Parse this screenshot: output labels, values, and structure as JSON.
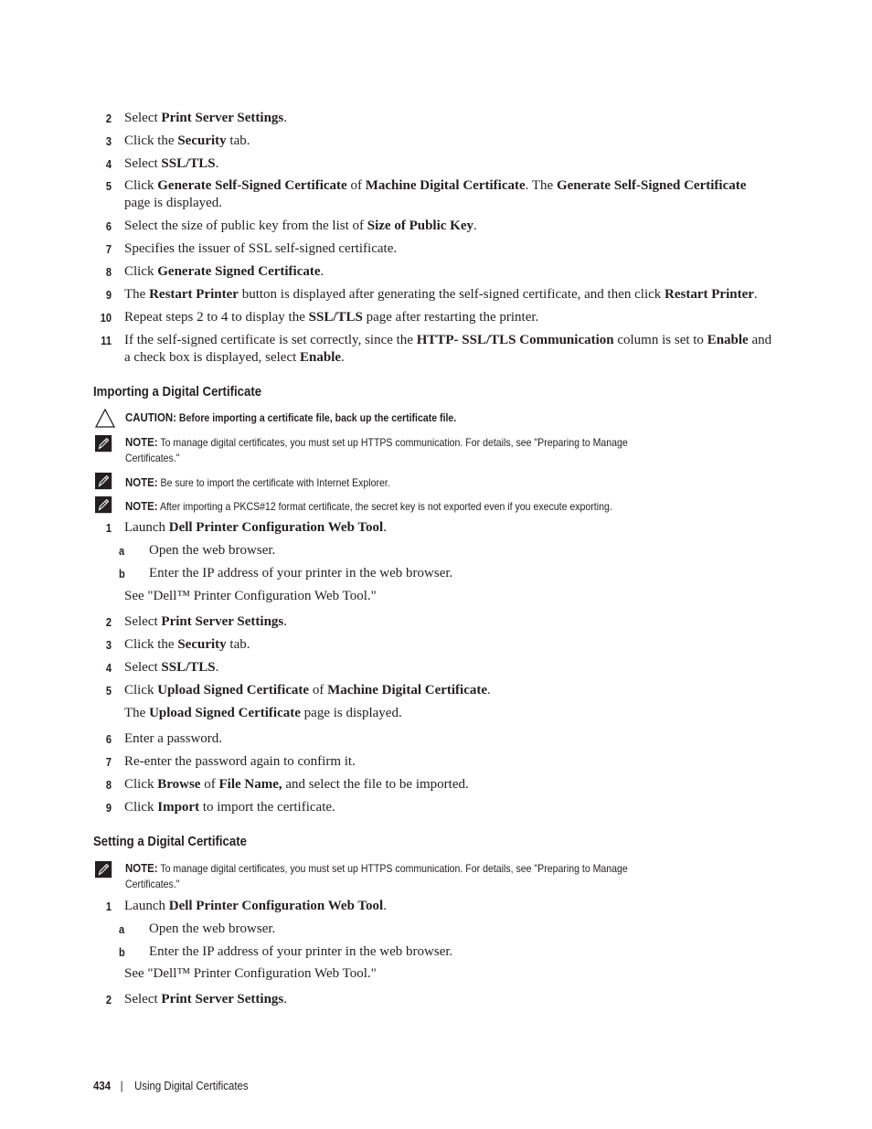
{
  "section1_steps": [
    {
      "num": "2",
      "parts": [
        "Select ",
        "Print Server Settings",
        "."
      ]
    },
    {
      "num": "3",
      "parts": [
        "Click the ",
        "Security",
        " tab."
      ]
    },
    {
      "num": "4",
      "parts": [
        "Select ",
        "SSL/TLS",
        "."
      ]
    },
    {
      "num": "5",
      "parts": [
        "Click ",
        "Generate Self-Signed Certificate",
        " of ",
        "Machine Digital Certificate",
        ". The ",
        "Generate Self-Signed Certificate",
        " page is displayed."
      ]
    },
    {
      "num": "6",
      "parts": [
        "Select the size of public key from the list of ",
        "Size of Public Key",
        "."
      ]
    },
    {
      "num": "7",
      "parts": [
        "Specifies the issuer of SSL self-signed certificate."
      ]
    },
    {
      "num": "8",
      "parts": [
        "Click ",
        "Generate Signed Certificate",
        "."
      ]
    },
    {
      "num": "9",
      "parts": [
        "The ",
        "Restart Printer",
        " button is displayed after generating the self-signed certificate, and then click ",
        "Restart Printer",
        "."
      ]
    },
    {
      "num": "10",
      "parts": [
        "Repeat steps 2 to 4 to display the ",
        "SSL/TLS",
        " page after restarting the printer."
      ]
    },
    {
      "num": "11",
      "parts": [
        "If the self-signed certificate is set correctly, since the ",
        "HTTP- SSL/TLS Communication",
        " column is set to ",
        "Enable",
        " and a check box is displayed, select ",
        "Enable",
        "."
      ]
    }
  ],
  "importing": {
    "heading": "Importing a Digital Certificate",
    "caution": {
      "label": "CAUTION:",
      "text": " Before importing a certificate file, back up the certificate file."
    },
    "notes": [
      {
        "label": "NOTE:",
        "line1": " To manage digital certificates, you must set up HTTPS communication. For details, see \"Preparing to Manage",
        "line2": "Certificates.\""
      },
      {
        "label": "NOTE:",
        "line1": " Be sure to import the certificate with Internet Explorer.",
        "line2": ""
      },
      {
        "label": "NOTE:",
        "line1": " After importing a PKCS#12 format certificate, the secret key is not exported even if you execute exporting.",
        "line2": ""
      }
    ],
    "step1": {
      "num": "1",
      "parts": [
        "Launch ",
        "Dell Printer Configuration Web Tool",
        "."
      ]
    },
    "substeps": [
      {
        "num": "a",
        "text": "Open the web browser."
      },
      {
        "num": "b",
        "text": "Enter the IP address of your printer in the web browser."
      }
    ],
    "see": "See \"Dell™ Printer Configuration Web Tool.\"",
    "steps": [
      {
        "num": "2",
        "parts": [
          "Select ",
          "Print Server Settings",
          "."
        ]
      },
      {
        "num": "3",
        "parts": [
          "Click the ",
          "Security",
          " tab."
        ]
      },
      {
        "num": "4",
        "parts": [
          "Select ",
          "SSL/TLS",
          "."
        ]
      },
      {
        "num": "5",
        "parts": [
          "Click ",
          "Upload Signed Certificate",
          " of ",
          "Machine Digital Certificate",
          "."
        ]
      }
    ],
    "step5_follow": [
      "The ",
      "Upload Signed Certificate",
      " page is displayed."
    ],
    "steps_after": [
      {
        "num": "6",
        "parts": [
          "Enter a password."
        ]
      },
      {
        "num": "7",
        "parts": [
          "Re-enter the password again to confirm it."
        ]
      },
      {
        "num": "8",
        "parts": [
          "Click ",
          "Browse",
          " of ",
          "File Name,",
          " and select the file to be imported."
        ]
      },
      {
        "num": "9",
        "parts": [
          "Click ",
          "Import",
          " to import the certificate."
        ]
      }
    ]
  },
  "setting": {
    "heading": "Setting a Digital Certificate",
    "note": {
      "label": "NOTE:",
      "line1": " To manage digital certificates, you must set up HTTPS communication. For details, see \"Preparing to Manage",
      "line2": "Certificates.\""
    },
    "step1": {
      "num": "1",
      "parts": [
        "Launch ",
        "Dell Printer Configuration Web Tool",
        "."
      ]
    },
    "substeps": [
      {
        "num": "a",
        "text": "Open the web browser."
      },
      {
        "num": "b",
        "text": "Enter the IP address of your printer in the web browser."
      }
    ],
    "see": "See \"Dell™ Printer Configuration Web Tool.\"",
    "step2": {
      "num": "2",
      "parts": [
        "Select ",
        "Print Server Settings",
        "."
      ]
    }
  },
  "footer": {
    "page": "434",
    "separator": "|",
    "title": "Using Digital Certificates"
  }
}
